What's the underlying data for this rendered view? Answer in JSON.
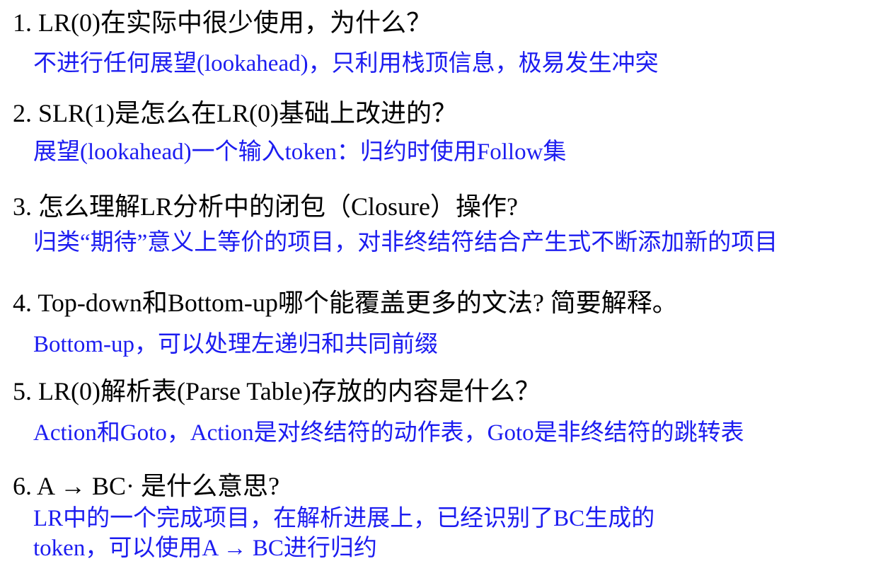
{
  "colors": {
    "question": "#000000",
    "answer": "#1c1cf0",
    "background": "#ffffff"
  },
  "items": [
    {
      "question": "1. LR(0)在实际中很少使用，为什么？",
      "answer": [
        "不进行任何展望(lookahead)，只利用栈顶信息，极易发生冲突"
      ]
    },
    {
      "question": "2. SLR(1)是怎么在LR(0)基础上改进的？",
      "answer": [
        "展望(lookahead)一个输入token：归约时使用Follow集"
      ]
    },
    {
      "question": "3. 怎么理解LR分析中的闭包（Closure）操作?",
      "answer": [
        "归类“期待”意义上等价的项目，对非终结符结合产生式不断添加新的项目"
      ]
    },
    {
      "question": "4. Top-down和Bottom-up哪个能覆盖更多的文法? 简要解释。",
      "answer": [
        "Bottom-up，可以处理左递归和共同前缀"
      ]
    },
    {
      "question": "5. LR(0)解析表(Parse Table)存放的内容是什么？",
      "answer": [
        "Action和Goto，Action是对终结符的动作表，Goto是非终结符的跳转表"
      ]
    },
    {
      "question": "6. A → BC· 是什么意思?",
      "answer": [
        "LR中的一个完成项目，在解析进展上，已经识别了BC生成的",
        "token，可以使用A → BC进行归约"
      ]
    }
  ]
}
